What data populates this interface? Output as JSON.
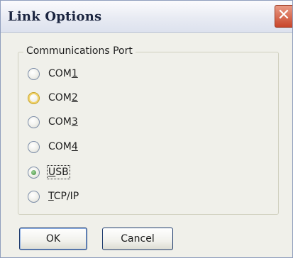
{
  "window": {
    "title": "Link Options",
    "close_symbol": "✕"
  },
  "group": {
    "label": "Communications Port",
    "options": [
      {
        "pre": "COM",
        "key": "1",
        "post": "",
        "checked": false
      },
      {
        "pre": "COM",
        "key": "2",
        "post": "",
        "checked": false
      },
      {
        "pre": "COM",
        "key": "3",
        "post": "",
        "checked": false
      },
      {
        "pre": "COM",
        "key": "4",
        "post": "",
        "checked": false
      },
      {
        "pre": "",
        "key": "U",
        "post": "SB",
        "checked": true
      },
      {
        "pre": "",
        "key": "T",
        "post": "CP/IP",
        "checked": false
      }
    ]
  },
  "buttons": {
    "ok_label": "OK",
    "cancel_label": "Cancel"
  }
}
